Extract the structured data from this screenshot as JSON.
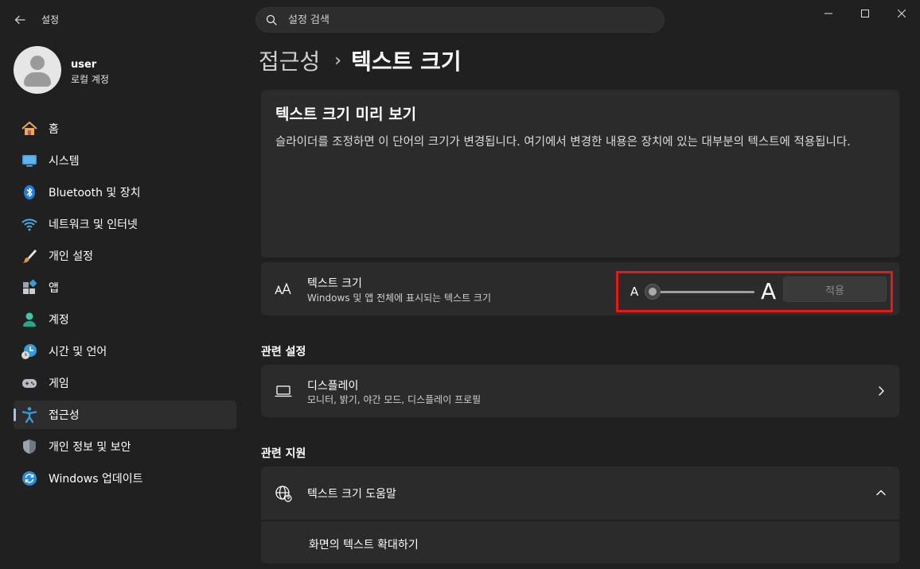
{
  "app": {
    "title": "설정"
  },
  "search": {
    "placeholder": "설정 검색"
  },
  "profile": {
    "name": "user",
    "account_type": "로컬 계정"
  },
  "nav": [
    {
      "label": "홈",
      "icon": "home-icon"
    },
    {
      "label": "시스템",
      "icon": "monitor-icon"
    },
    {
      "label": "Bluetooth 및 장치",
      "icon": "bluetooth-icon"
    },
    {
      "label": "네트워크 및 인터넷",
      "icon": "wifi-icon"
    },
    {
      "label": "개인 설정",
      "icon": "brush-icon"
    },
    {
      "label": "앱",
      "icon": "apps-icon"
    },
    {
      "label": "계정",
      "icon": "person-icon"
    },
    {
      "label": "시간 및 언어",
      "icon": "clock-globe-icon"
    },
    {
      "label": "게임",
      "icon": "gamepad-icon"
    },
    {
      "label": "접근성",
      "icon": "accessibility-icon",
      "active": true
    },
    {
      "label": "개인 정보 및 보안",
      "icon": "shield-icon"
    },
    {
      "label": "Windows 업데이트",
      "icon": "update-icon"
    }
  ],
  "breadcrumb": {
    "parent": "접근성",
    "separator": "›",
    "current": "텍스트 크기"
  },
  "preview": {
    "title": "텍스트 크기 미리 보기",
    "text": "슬라이더를 조정하면 이 단어의 크기가 변경됩니다. 여기에서 변경한 내용은 장치에 있는 대부분의 텍스트에 적용됩니다."
  },
  "text_size": {
    "title": "텍스트 크기",
    "description": "Windows 및 앱 전체에 표시되는 텍스트 크기",
    "small_label": "A",
    "large_label": "A",
    "slider_value": 0,
    "apply_label": "적용"
  },
  "related_settings": {
    "heading": "관련 설정",
    "display": {
      "title": "디스플레이",
      "description": "모니터, 밝기, 야간 모드, 디스플레이 프로필"
    }
  },
  "related_support": {
    "heading": "관련 지원",
    "help": {
      "title": "텍스트 크기 도움말",
      "link": "화면의 텍스트 확대하기"
    }
  },
  "colors": {
    "accent": "#9cc3ea",
    "highlight": "#e61919",
    "background": "#202020",
    "card": "#2b2b2b"
  }
}
